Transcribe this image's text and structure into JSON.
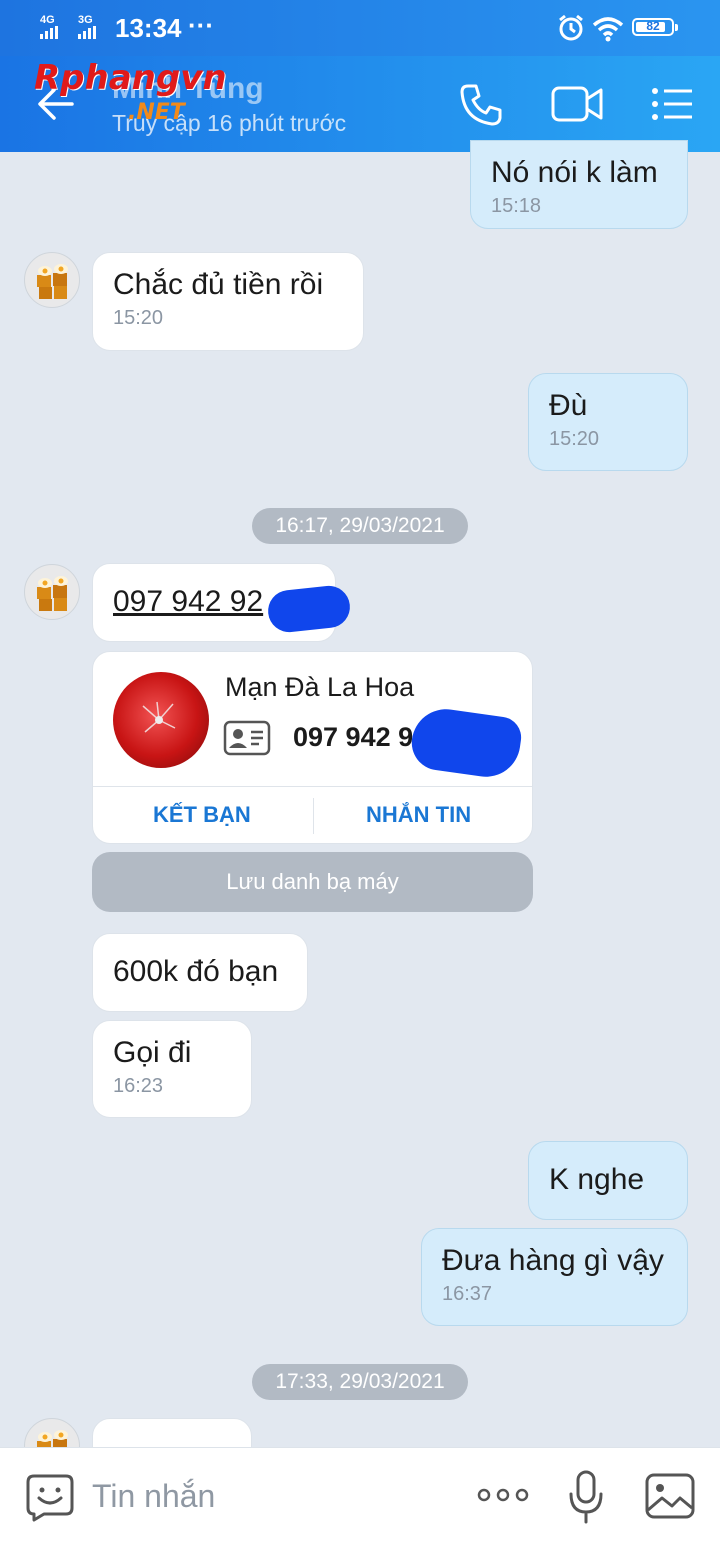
{
  "status_bar": {
    "signal_1": "4G",
    "signal_2": "3G",
    "time": "13:34",
    "more": "···",
    "battery": "82"
  },
  "header": {
    "logo_primary": "Rphangvn",
    "logo_secondary": ".NET",
    "contact_name": "Minh Tùng",
    "last_seen": "Truy cập 16 phút trước",
    "icons": [
      "back-arrow-icon",
      "phone-icon",
      "video-call-icon",
      "menu-list-icon"
    ]
  },
  "messages": {
    "m1": {
      "text": "Nó nói k làm",
      "time": "15:18",
      "sender": "me"
    },
    "m2": {
      "text": "Chắc đủ tiền rồi",
      "time": "15:20",
      "sender": "them"
    },
    "m3": {
      "text": "Đù",
      "time": "15:20",
      "sender": "me"
    },
    "date1": "16:17, 29/03/2021",
    "m4": {
      "text": "097 942 92",
      "sender": "them"
    },
    "contact_card": {
      "name": "Mạn Đà La Hoa",
      "phone": "097 942 9",
      "add_friend": "KẾT BẠN",
      "message": "NHẮN TIN",
      "save_contact": "Lưu danh bạ máy"
    },
    "m5": {
      "text": "600k đó bạn",
      "sender": "them"
    },
    "m6": {
      "text": "Gọi đi",
      "time": "16:23",
      "sender": "them"
    },
    "m7": {
      "text": "K nghe",
      "sender": "me"
    },
    "m8": {
      "text": "Đưa hàng gì vậy",
      "time": "16:37",
      "sender": "me"
    },
    "date2": "17:33, 29/03/2021"
  },
  "composer": {
    "placeholder": "Tin nhắn",
    "icons": [
      "emoji-icon",
      "more-icon",
      "microphone-icon",
      "image-icon"
    ]
  },
  "colors": {
    "header": "#2196f3",
    "my_bubble": "#d5ecfb",
    "their_bubble": "#ffffff",
    "link": "#1a77d4",
    "background": "#e2e8f0"
  }
}
